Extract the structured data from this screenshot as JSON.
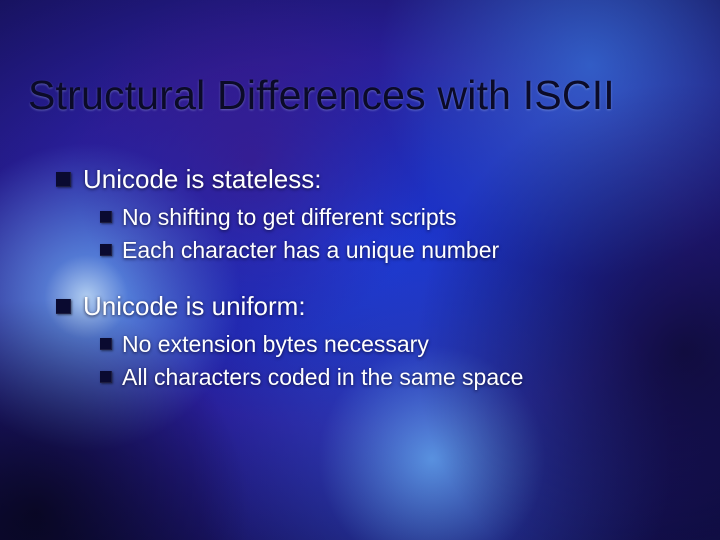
{
  "title": "Structural Differences with ISCII",
  "bullets": [
    {
      "text": "Unicode is stateless:",
      "children": [
        {
          "text": "No shifting to get different scripts"
        },
        {
          "text": "Each character has a unique number"
        }
      ]
    },
    {
      "text": "Unicode is uniform:",
      "children": [
        {
          "text": "No extension bytes necessary"
        },
        {
          "text": "All characters coded in the same space"
        }
      ]
    }
  ]
}
